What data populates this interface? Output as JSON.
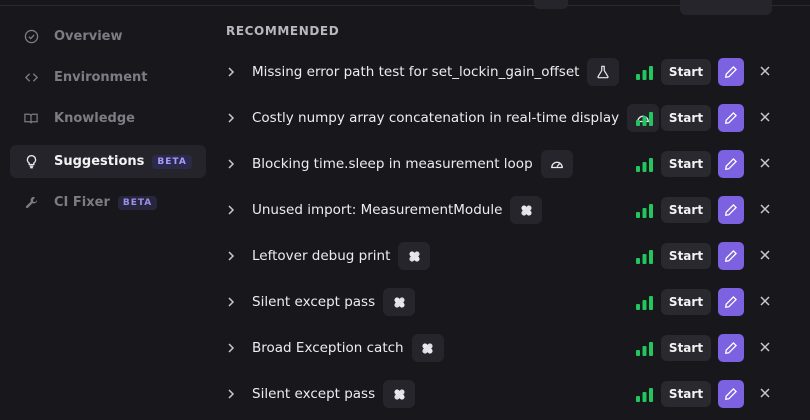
{
  "sidebar": {
    "items": [
      {
        "label": "Overview",
        "icon": "check-circle-icon",
        "active": false
      },
      {
        "label": "Environment",
        "icon": "code-brackets-icon",
        "active": false
      },
      {
        "label": "Knowledge",
        "icon": "book-open-icon",
        "active": false
      },
      {
        "label": "Suggestions",
        "icon": "lightbulb-icon",
        "active": true,
        "badge": "BETA"
      },
      {
        "label": "CI Fixer",
        "icon": "wrench-icon",
        "active": false,
        "badge": "BETA"
      }
    ]
  },
  "section": {
    "title": "RECOMMENDED"
  },
  "suggestions": [
    {
      "title": "Missing error path test for set_lockin_gain_offset",
      "tag_icon": "flask-icon",
      "action": "Start"
    },
    {
      "title": "Costly numpy array concatenation in real-time display",
      "tag_icon": "gauge-icon",
      "action": "Start"
    },
    {
      "title": "Blocking time.sleep in measurement loop",
      "tag_icon": "gauge-icon",
      "action": "Start"
    },
    {
      "title": "Unused import: MeasurementModule",
      "tag_icon": "bandage-icon",
      "action": "Start"
    },
    {
      "title": "Leftover debug print",
      "tag_icon": "bandage-icon",
      "action": "Start"
    },
    {
      "title": "Silent except pass",
      "tag_icon": "bandage-icon",
      "action": "Start"
    },
    {
      "title": "Broad Exception catch",
      "tag_icon": "bandage-icon",
      "action": "Start"
    },
    {
      "title": "Silent except pass",
      "tag_icon": "bandage-icon",
      "action": "Start"
    }
  ],
  "colors": {
    "accent": "#7c62e0",
    "signal": "#22c55e",
    "background": "#18171c"
  }
}
